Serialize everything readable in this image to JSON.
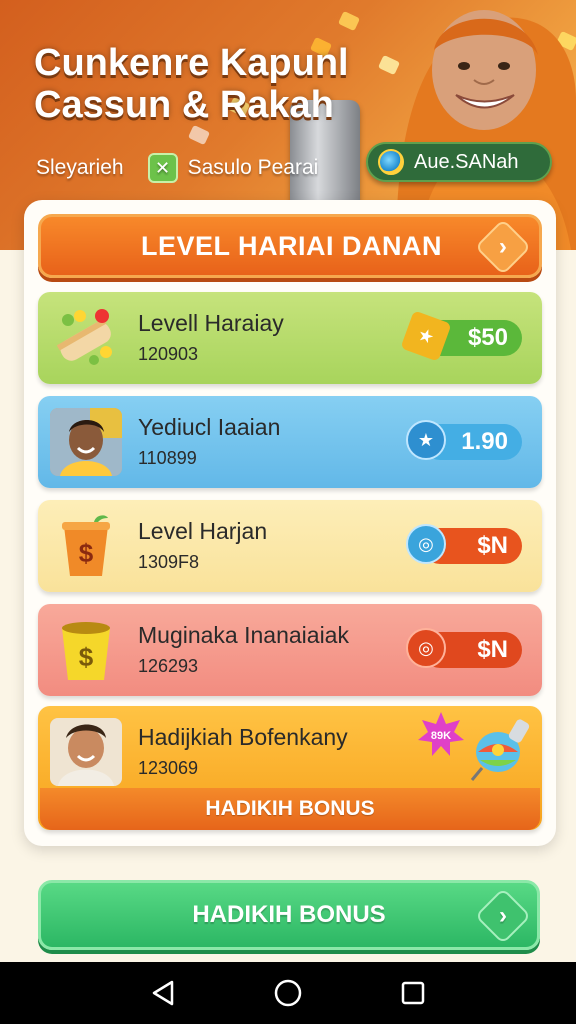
{
  "header": {
    "title_line1": "Cunkenre Kapunl",
    "title_line2": "Cassun & Rakah",
    "left_label": "Sleyarieh",
    "check_label": "Sasulo Pearai",
    "badge_label": "Aue.SANah"
  },
  "banner": {
    "label": "LEVEL HARIAI DANAN"
  },
  "rows": [
    {
      "title": "Levell Haraiay",
      "sub": "120903",
      "reward": "$50",
      "icon": "fruit-roll-icon",
      "reward_color": "#6cc24a"
    },
    {
      "title": "Yediucl Iaaian",
      "sub": "110899",
      "reward": "1.90",
      "icon": "person-avatar",
      "reward_color": "#3aa4dc"
    },
    {
      "title": "Level Harjan",
      "sub": "1309F8",
      "reward": "$N",
      "icon": "dollar-cup-icon",
      "reward_color": "#e8541e"
    },
    {
      "title": "Muginaka Inanaiaiak",
      "sub": "126293",
      "reward": "$N",
      "icon": "dollar-bucket-icon",
      "reward_color": "#e0481e"
    },
    {
      "title": "Hadijkiah Bofenkany",
      "sub": "123069",
      "badge": "89K",
      "icon": "person-avatar"
    }
  ],
  "row_bonus_label": "HADIKIH BONUS",
  "cta": {
    "label": "HADIKIH BONUS"
  },
  "colors": {
    "accent_orange": "#e8621a",
    "accent_green": "#2cb764"
  }
}
